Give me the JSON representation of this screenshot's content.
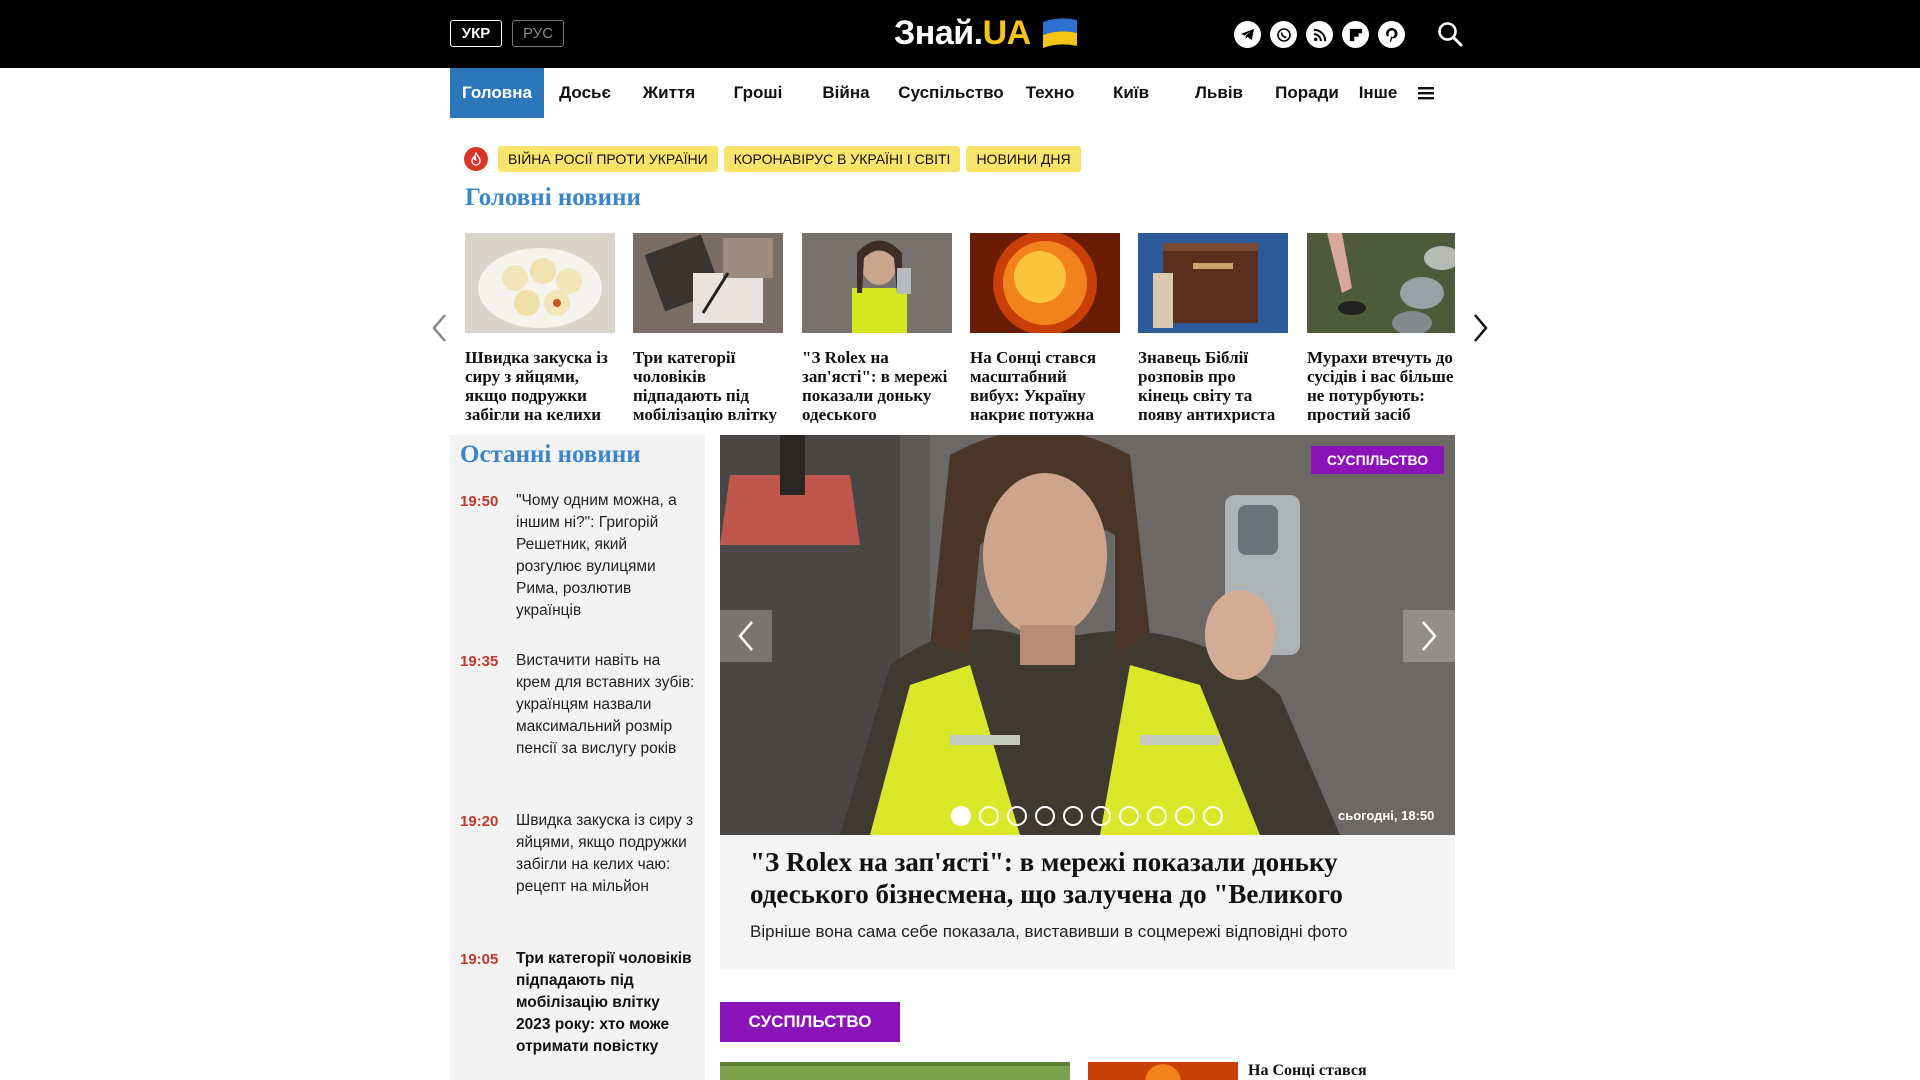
{
  "header": {
    "lang_ukr": "УКР",
    "lang_rus": "РУС",
    "logo_main": "Знай.",
    "logo_accent": "UA",
    "socials": [
      "telegram-icon",
      "viber-icon",
      "rss-icon",
      "flipboard-icon",
      "pinterest-icon"
    ],
    "search_icon": "search-icon"
  },
  "nav": {
    "items": [
      "Головна",
      "Досьє",
      "Життя",
      "Гроші",
      "Війна",
      "Суспільство",
      "Техно",
      "Київ",
      "Львів",
      "Поради",
      "Інше"
    ],
    "active": "Головна"
  },
  "tags": [
    "ВІЙНА РОСІЇ ПРОТИ УКРАЇНИ",
    "КОРОНАВІРУС В УКРАЇНІ І СВІТІ",
    "НОВИНИ ДНЯ"
  ],
  "main_news": {
    "title": "Головні новини",
    "cards": [
      "Швидка закуска із сиру з яйцями, якщо подружки забігли на келихи чаю",
      "Три категорії чоловіків підпадають під мобілізацію влітку",
      "\"З Rolex на зап'ясті\": в мережі показали доньку одеського бізнесмена",
      "На Сонці стався масштабний вибух: Україну накриє потужна буря",
      "Знавець Біблії розповів про кінець світу та появу антихриста",
      "Мурахи втечуть до сусідів і вас більше не потурбують: простий засіб"
    ]
  },
  "latest": {
    "title": "Останні новини",
    "items": [
      {
        "time": "19:50",
        "text": "\"Чому одним можна, а іншим ні?\": Григорій Решетник, який розгулює вулицями Рима, розлютив українців"
      },
      {
        "time": "19:35",
        "text": "Вистачити навіть на крем для вставних зубів: українцям назвали максимальний розмір пенсії за вислугу років"
      },
      {
        "time": "19:20",
        "text": "Швидка закуска із сиру з яйцями, якщо подружки забігли на келих чаю: рецепт на мільйон"
      },
      {
        "time": "19:05",
        "text": "Три категорії чоловіків підпадають під мобілізацію влітку 2023 року: хто може отримати повістку"
      }
    ]
  },
  "hero": {
    "badge": "СУСПІЛЬСТВО",
    "date": "сьогодні, 18:50",
    "title": "\"З Rolex на зап'ясті\": в мережі показали доньку одеського бізнесмена, що залучена до \"Великого будівництва\"",
    "lead": "Вірніше вона сама себе показала, виставивши в соцмережі відповідні фото",
    "slides": 10,
    "active_slide": 1
  },
  "category": {
    "label": "СУСПІЛЬСТВО",
    "next_title": "На Сонці стався"
  },
  "colors": {
    "accent_blue": "#2b77b9",
    "section_blue": "#3a86c8",
    "badge_purple": "#8a14b8",
    "tag_yellow": "#f8e36b",
    "time_red": "#c0392b"
  }
}
